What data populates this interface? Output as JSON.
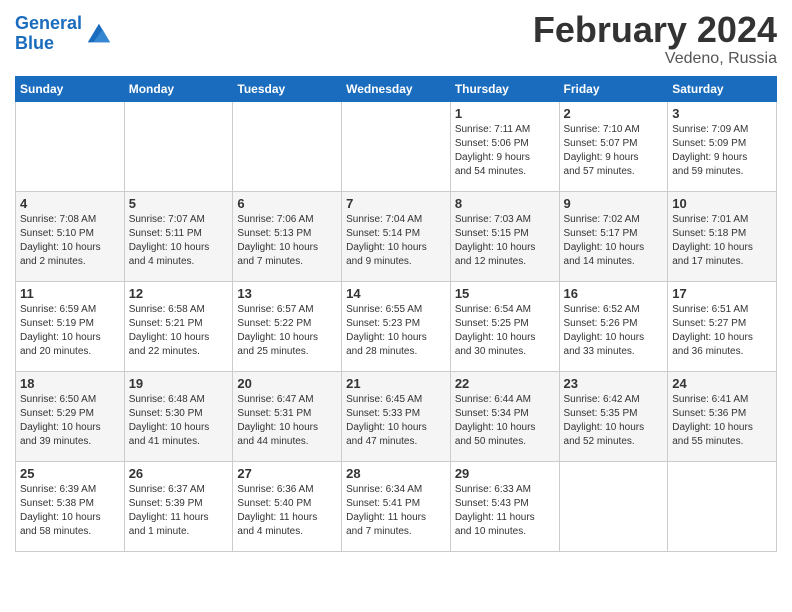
{
  "header": {
    "logo_line1": "General",
    "logo_line2": "Blue",
    "month_title": "February 2024",
    "location": "Vedeno, Russia"
  },
  "weekdays": [
    "Sunday",
    "Monday",
    "Tuesday",
    "Wednesday",
    "Thursday",
    "Friday",
    "Saturday"
  ],
  "weeks": [
    [
      {
        "day": "",
        "info": ""
      },
      {
        "day": "",
        "info": ""
      },
      {
        "day": "",
        "info": ""
      },
      {
        "day": "",
        "info": ""
      },
      {
        "day": "1",
        "info": "Sunrise: 7:11 AM\nSunset: 5:06 PM\nDaylight: 9 hours\nand 54 minutes."
      },
      {
        "day": "2",
        "info": "Sunrise: 7:10 AM\nSunset: 5:07 PM\nDaylight: 9 hours\nand 57 minutes."
      },
      {
        "day": "3",
        "info": "Sunrise: 7:09 AM\nSunset: 5:09 PM\nDaylight: 9 hours\nand 59 minutes."
      }
    ],
    [
      {
        "day": "4",
        "info": "Sunrise: 7:08 AM\nSunset: 5:10 PM\nDaylight: 10 hours\nand 2 minutes."
      },
      {
        "day": "5",
        "info": "Sunrise: 7:07 AM\nSunset: 5:11 PM\nDaylight: 10 hours\nand 4 minutes."
      },
      {
        "day": "6",
        "info": "Sunrise: 7:06 AM\nSunset: 5:13 PM\nDaylight: 10 hours\nand 7 minutes."
      },
      {
        "day": "7",
        "info": "Sunrise: 7:04 AM\nSunset: 5:14 PM\nDaylight: 10 hours\nand 9 minutes."
      },
      {
        "day": "8",
        "info": "Sunrise: 7:03 AM\nSunset: 5:15 PM\nDaylight: 10 hours\nand 12 minutes."
      },
      {
        "day": "9",
        "info": "Sunrise: 7:02 AM\nSunset: 5:17 PM\nDaylight: 10 hours\nand 14 minutes."
      },
      {
        "day": "10",
        "info": "Sunrise: 7:01 AM\nSunset: 5:18 PM\nDaylight: 10 hours\nand 17 minutes."
      }
    ],
    [
      {
        "day": "11",
        "info": "Sunrise: 6:59 AM\nSunset: 5:19 PM\nDaylight: 10 hours\nand 20 minutes."
      },
      {
        "day": "12",
        "info": "Sunrise: 6:58 AM\nSunset: 5:21 PM\nDaylight: 10 hours\nand 22 minutes."
      },
      {
        "day": "13",
        "info": "Sunrise: 6:57 AM\nSunset: 5:22 PM\nDaylight: 10 hours\nand 25 minutes."
      },
      {
        "day": "14",
        "info": "Sunrise: 6:55 AM\nSunset: 5:23 PM\nDaylight: 10 hours\nand 28 minutes."
      },
      {
        "day": "15",
        "info": "Sunrise: 6:54 AM\nSunset: 5:25 PM\nDaylight: 10 hours\nand 30 minutes."
      },
      {
        "day": "16",
        "info": "Sunrise: 6:52 AM\nSunset: 5:26 PM\nDaylight: 10 hours\nand 33 minutes."
      },
      {
        "day": "17",
        "info": "Sunrise: 6:51 AM\nSunset: 5:27 PM\nDaylight: 10 hours\nand 36 minutes."
      }
    ],
    [
      {
        "day": "18",
        "info": "Sunrise: 6:50 AM\nSunset: 5:29 PM\nDaylight: 10 hours\nand 39 minutes."
      },
      {
        "day": "19",
        "info": "Sunrise: 6:48 AM\nSunset: 5:30 PM\nDaylight: 10 hours\nand 41 minutes."
      },
      {
        "day": "20",
        "info": "Sunrise: 6:47 AM\nSunset: 5:31 PM\nDaylight: 10 hours\nand 44 minutes."
      },
      {
        "day": "21",
        "info": "Sunrise: 6:45 AM\nSunset: 5:33 PM\nDaylight: 10 hours\nand 47 minutes."
      },
      {
        "day": "22",
        "info": "Sunrise: 6:44 AM\nSunset: 5:34 PM\nDaylight: 10 hours\nand 50 minutes."
      },
      {
        "day": "23",
        "info": "Sunrise: 6:42 AM\nSunset: 5:35 PM\nDaylight: 10 hours\nand 52 minutes."
      },
      {
        "day": "24",
        "info": "Sunrise: 6:41 AM\nSunset: 5:36 PM\nDaylight: 10 hours\nand 55 minutes."
      }
    ],
    [
      {
        "day": "25",
        "info": "Sunrise: 6:39 AM\nSunset: 5:38 PM\nDaylight: 10 hours\nand 58 minutes."
      },
      {
        "day": "26",
        "info": "Sunrise: 6:37 AM\nSunset: 5:39 PM\nDaylight: 11 hours\nand 1 minute."
      },
      {
        "day": "27",
        "info": "Sunrise: 6:36 AM\nSunset: 5:40 PM\nDaylight: 11 hours\nand 4 minutes."
      },
      {
        "day": "28",
        "info": "Sunrise: 6:34 AM\nSunset: 5:41 PM\nDaylight: 11 hours\nand 7 minutes."
      },
      {
        "day": "29",
        "info": "Sunrise: 6:33 AM\nSunset: 5:43 PM\nDaylight: 11 hours\nand 10 minutes."
      },
      {
        "day": "",
        "info": ""
      },
      {
        "day": "",
        "info": ""
      }
    ]
  ]
}
